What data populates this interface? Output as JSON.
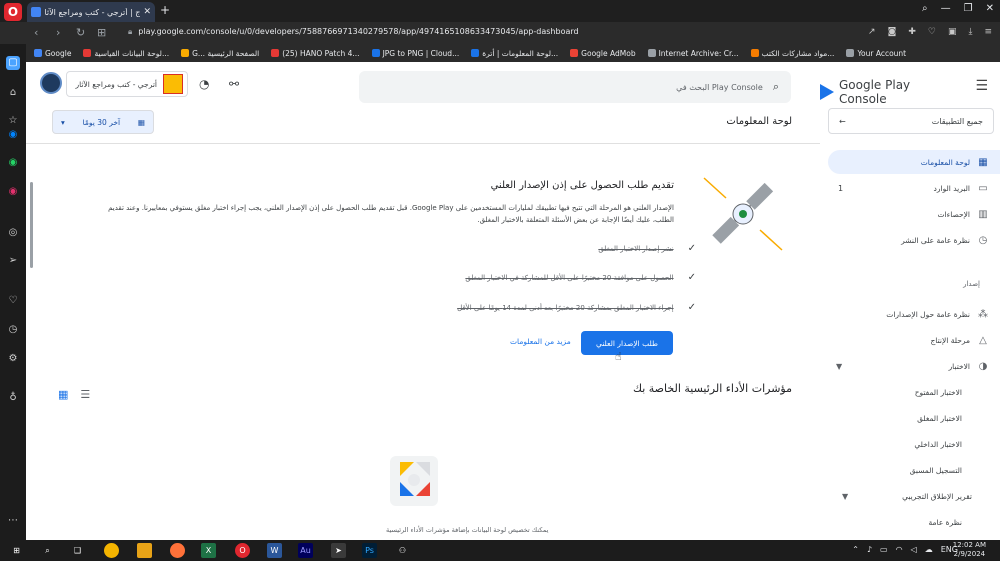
{
  "browser": {
    "tab_title": "ج | أترجي - كتب ومراجع الآثار",
    "url": "play.google.com/console/u/0/developers/7588766971340279578/app/4974165108633473045/app-dashboard",
    "bookmarks": [
      "Google",
      "لوحة البيانات القياسية...",
      "G... الصفحة الرئيسية",
      "(25) HANO Patch 4...",
      "JPG to PNG | Cloud...",
      "لوحة المعلومات | أترة...",
      "Google AdMob",
      "Internet Archive: Cr...",
      "مواد مشاركات الكتب...",
      "Your Account"
    ]
  },
  "nav": {
    "brand": "Google Play Console",
    "all_apps": "جميع التطبيقات",
    "items": [
      {
        "label": "لوحة المعلومات",
        "icon": "dashboard-icon"
      },
      {
        "label": "البريد الوارد",
        "icon": "inbox-icon",
        "badge": "1"
      },
      {
        "label": "الإحصاءات",
        "icon": "stats-icon"
      },
      {
        "label": "نظرة عامة على النشر",
        "icon": "publishing-icon"
      }
    ],
    "section_label": "إصدار",
    "release_items": [
      {
        "label": "نظرة عامة حول الإصدارات",
        "icon": "releases-icon"
      },
      {
        "label": "مرحلة الإنتاج",
        "icon": "production-icon"
      },
      {
        "label": "الاختبار",
        "icon": "testing-icon"
      }
    ],
    "testing_sub": [
      "الاختبار المفتوح",
      "الاختبار المغلق",
      "الاختبار الداخلي",
      "التسجيل المسبق"
    ],
    "prerelease_label": "تقرير الإطلاق التجريبي",
    "prerelease_sub": [
      "نظرة عامة"
    ]
  },
  "header": {
    "app_name": "أترجي - كتب ومراجع الآثار",
    "search_placeholder": "البحث في Play Console",
    "date_range": "آخر 30 يومًا",
    "page_title": "لوحة المعلومات"
  },
  "card": {
    "title": "تقديم طلب الحصول على إذن الإصدار العلني",
    "description": "الإصدار العلني هو المرحلة التي تتيح فيها تطبيقك لمليارات المستخدمين على Google Play. قبل تقديم طلب الحصول على إذن الإصدار العلني، يجب إجراء اختبار مغلق يستوفي بمعاييرنا. وعند تقديم الطلب، عليك أيضًا الإجابة عن بعض الأسئلة المتعلقة بالاختبار المغلق.",
    "checklist": [
      "نشر إصدار الاختبار المغلق",
      "الحصول على موافقة 20 مختبرًا على الأقل للمشاركة في الاختبار المغلق",
      "إجراء الاختبار المغلق بمشاركة 20 مختبرًا بعد أدنى لمدة 14 يومًا على الأقل"
    ],
    "primary_button": "طلب الإصدار العلني",
    "secondary_link": "مزيد من المعلومات"
  },
  "kpi": {
    "title": "مؤشرات الأداء الرئيسية الخاصة بك",
    "text": "يمكنك تخصيص لوحة البيانات بإضافة مؤشرات الأداء الرئيسية"
  },
  "taskbar": {
    "lang": "ENG",
    "time": "12:02 AM",
    "date": "2/9/2024"
  },
  "colors": {
    "accent": "#1a73e8",
    "nav_active_bg": "#e8f0fe",
    "chrome_bg": "#2b2b2b"
  }
}
